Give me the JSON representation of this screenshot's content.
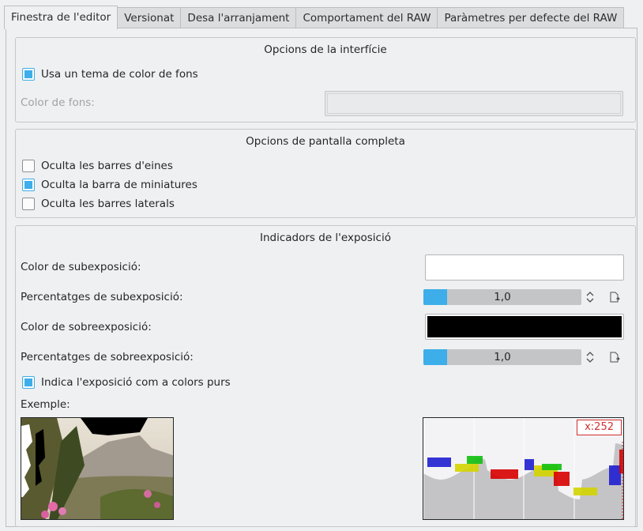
{
  "tabs": [
    {
      "label": "Finestra de l'editor",
      "active": true
    },
    {
      "label": "Versionat",
      "active": false
    },
    {
      "label": "Desa l'arranjament",
      "active": false
    },
    {
      "label": "Comportament del RAW",
      "active": false
    },
    {
      "label": "Paràmetres per defecte del RAW",
      "active": false
    }
  ],
  "interface_options": {
    "title": "Opcions de la interfície",
    "use_theme_label": "Usa un tema de color de fons",
    "use_theme_checked": true,
    "bg_color_label": "Color de fons:"
  },
  "fullscreen_options": {
    "title": "Opcions de pantalla completa",
    "hide_toolbars_label": "Oculta les barres d'eines",
    "hide_toolbars_checked": false,
    "hide_thumbbar_label": "Oculta la barra de miniatures",
    "hide_thumbbar_checked": true,
    "hide_sidebars_label": "Oculta les barres laterals",
    "hide_sidebars_checked": false
  },
  "exposure": {
    "title": "Indicadors de l'exposició",
    "under_color_label": "Color de subexposició:",
    "under_color": "#ffffff",
    "under_pct_label": "Percentatges de subexposició:",
    "under_pct_value": "1,0",
    "under_pct_fraction": 0.15,
    "over_color_label": "Color de sobreexposició:",
    "over_color": "#000000",
    "over_pct_label": "Percentatges de sobreexposició:",
    "over_pct_value": "1,0",
    "over_pct_fraction": 0.15,
    "pure_colors_label": "Indica l'exposició com a colors purs",
    "pure_colors_checked": true,
    "example_label": "Exemple:",
    "histogram_readout": "x:252"
  },
  "colors": {
    "accent": "#3daee9",
    "badge": "#d32f2f"
  }
}
